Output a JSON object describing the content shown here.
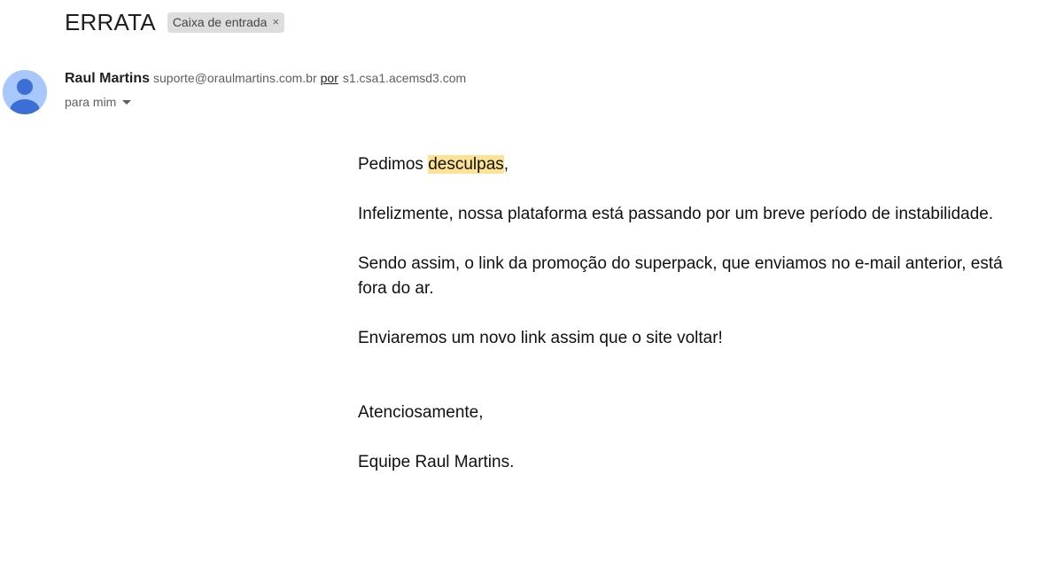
{
  "email": {
    "subject": "ERRATA",
    "label": "Caixa de entrada",
    "label_close": "×",
    "sender": {
      "name": "Raul Martins",
      "email": "suporte@oraulmartins.com.br",
      "via_label": "por",
      "via_domain": "s1.csa1.acemsd3.com",
      "avatar_icon": "person-icon",
      "avatar_color": "#a8c7fa"
    },
    "recipient": "para mim",
    "body": {
      "greeting_prefix": "Pedimos ",
      "greeting_highlight": "desculpas",
      "greeting_suffix": ",",
      "paragraph1": "Infelizmente, nossa plataforma está passando por um breve período de instabilidade.",
      "paragraph2_line1": "Sendo assim, o link da promoção do superpack, que enviamos no e-mail anterior, está",
      "paragraph2_line2": "fora do ar.",
      "paragraph3": "Enviaremos um novo link assim que o site voltar!",
      "closing": "Atenciosamente,",
      "signature": "Equipe Raul Martins."
    },
    "highlight_color": "#fde293"
  }
}
